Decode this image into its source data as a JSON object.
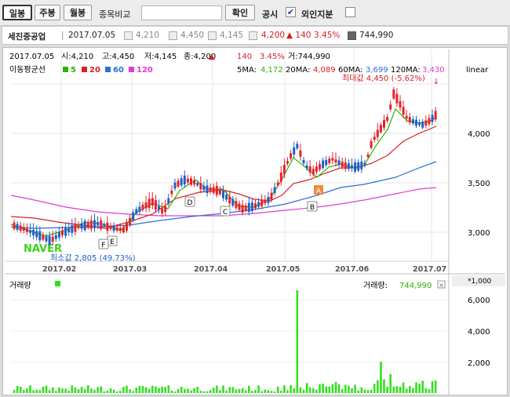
{
  "toolbar": {
    "daily": "일봉",
    "weekly": "주봉",
    "monthly": "월봉",
    "compare_label": "종목비교",
    "confirm": "확인",
    "disclosure": "공시",
    "disclosure_checked": "✔",
    "foreign_label": "외인지분"
  },
  "info": {
    "name": "세진중공업",
    "date": "2017.07.05",
    "open": "4,210",
    "high": "4,450",
    "low": "4,145",
    "close": "4,200",
    "change": "▲ 140",
    "pct": "3.45%",
    "volume": "744,990"
  },
  "chart": {
    "row1": {
      "date": "2017.07.05",
      "open": "시:4,210",
      "high": "고:4,450",
      "low": "저:4,145",
      "close": "종:4,200",
      "arrow": "▲",
      "change": "140",
      "pct": "3.45%",
      "vol": "거:744,990"
    },
    "row2": {
      "ma_label": "이동평균선",
      "ma5": "5",
      "ma20": "20",
      "ma60": "60",
      "ma120": "120",
      "ma5_val_label": "5MA:",
      "ma5_val": "4,172",
      "ma20_val_label": "20MA:",
      "ma20_val": "4,089",
      "ma60_val_label": "60MA:",
      "ma60_val": "3,699",
      "ma120_val_label": "120MA:",
      "ma120_val": "3,430"
    },
    "scale_label": "linear",
    "max_label": "최대값 4,450 (-5.62%)",
    "min_label": "최소값 2,805 (49.73%)",
    "watermark": "NAVER",
    "y_ticks": [
      "4,000",
      "3,500",
      "3,000"
    ],
    "x_ticks": [
      "2017.02",
      "2017.03",
      "2017.04",
      "2017.05",
      "2017.06",
      "2017.07"
    ],
    "markers": [
      "A",
      "B",
      "C",
      "D",
      "E",
      "F"
    ],
    "volume": {
      "label": "거래량",
      "label_right": "거래량:",
      "value": "744,990",
      "unit": "*1,000",
      "y_ticks": [
        "6,000",
        "4,000",
        "2,000"
      ]
    }
  },
  "colors": {
    "up": "#e8202a",
    "down": "#1f5fc8",
    "ma5": "#2db300",
    "ma20": "#d81f26",
    "ma60": "#2a6fd6",
    "ma120": "#e03cd0",
    "volume": "#33e01e",
    "value_red": "#d81f26",
    "value_blue": "#1f5fc8"
  }
}
